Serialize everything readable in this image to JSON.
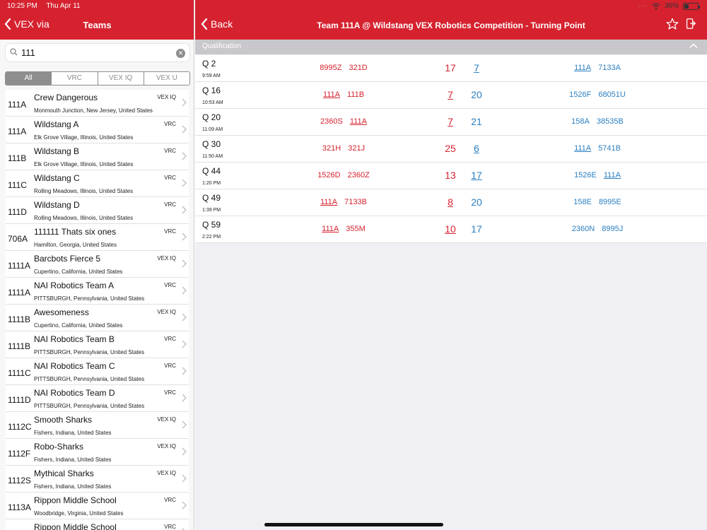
{
  "status": {
    "time": "10:25 PM",
    "date": "Thu Apr 11",
    "battery": "36%",
    "battery_level": 0.36
  },
  "left": {
    "back_label": "VEX via",
    "title": "Teams",
    "search_value": "111",
    "segments": [
      "All",
      "VRC",
      "VEX IQ",
      "VEX U"
    ],
    "teams": [
      {
        "number": "111A",
        "name": "Crew Dangerous",
        "location": "Monmouth Junction, New Jersey, United States",
        "program": "VEX IQ"
      },
      {
        "number": "111A",
        "name": "Wildstang A",
        "location": "Elk Grove Village, Illinois, United States",
        "program": "VRC"
      },
      {
        "number": "111B",
        "name": "Wildstang B",
        "location": "Elk Grove Village, Illinois, United States",
        "program": "VRC"
      },
      {
        "number": "111C",
        "name": "Wildstang C",
        "location": "Rolling Meadows, Illinois, United States",
        "program": "VRC"
      },
      {
        "number": "111D",
        "name": "Wildstang D",
        "location": "Rolling Meadows, Illinois, United States",
        "program": "VRC"
      },
      {
        "number": "706A",
        "name": "111111 Thats six ones",
        "location": "Hamilton, Georgia, United States",
        "program": "VRC"
      },
      {
        "number": "1111A",
        "name": "Barcbots Fierce 5",
        "location": "Cupertino, California, United States",
        "program": "VEX IQ"
      },
      {
        "number": "1111A",
        "name": "NAI Robotics Team A",
        "location": "PITTSBURGH, Pennsylvania, United States",
        "program": "VRC"
      },
      {
        "number": "1111B",
        "name": "Awesomeness",
        "location": "Cupertino, California, United States",
        "program": "VEX IQ"
      },
      {
        "number": "1111B",
        "name": "NAI Robotics Team B",
        "location": "PITTSBURGH, Pennsylvania, United States",
        "program": "VRC"
      },
      {
        "number": "1111C",
        "name": "NAI Robotics Team C",
        "location": "PITTSBURGH, Pennsylvania, United States",
        "program": "VRC"
      },
      {
        "number": "1111D",
        "name": "NAI Robotics Team D",
        "location": "PITTSBURGH, Pennsylvania, United States",
        "program": "VRC"
      },
      {
        "number": "1112C",
        "name": "Smooth Sharks",
        "location": "Fishers, Indiana, United States",
        "program": "VEX IQ"
      },
      {
        "number": "1112F",
        "name": "Robo-Sharks",
        "location": "Fishers, Indiana, United States",
        "program": "VEX IQ"
      },
      {
        "number": "1112S",
        "name": "Mythical Sharks",
        "location": "Fishers, Indiana, United States",
        "program": "VEX IQ"
      },
      {
        "number": "1113A",
        "name": "Rippon Middle School",
        "location": "Woodbridge, Virginia, United States",
        "program": "VRC"
      },
      {
        "number": "",
        "name": "Rippon Middle School",
        "location": "",
        "program": "VRC"
      }
    ]
  },
  "right": {
    "back_label": "Back",
    "title": "Team 111A @ Wildstang VEX Robotics Competition - Turning Point",
    "section_label": "Qualification",
    "matches": [
      {
        "name": "Q 2",
        "time": "9:59 AM",
        "red": [
          "8995Z",
          "321D"
        ],
        "red_score": "17",
        "blue_score": "7",
        "blue": [
          "111A",
          "7133A"
        ],
        "team_side": "blue",
        "team_idx": 0,
        "winner": "red"
      },
      {
        "name": "Q 16",
        "time": "10:53 AM",
        "red": [
          "111A",
          "111B"
        ],
        "red_score": "7",
        "blue_score": "20",
        "blue": [
          "1526F",
          "68051U"
        ],
        "team_side": "red",
        "team_idx": 0,
        "winner": "blue"
      },
      {
        "name": "Q 20",
        "time": "11:09 AM",
        "red": [
          "2360S",
          "111A"
        ],
        "red_score": "7",
        "blue_score": "21",
        "blue": [
          "158A",
          "38535B"
        ],
        "team_side": "red",
        "team_idx": 1,
        "winner": "blue"
      },
      {
        "name": "Q 30",
        "time": "11:50 AM",
        "red": [
          "321H",
          "321J"
        ],
        "red_score": "25",
        "blue_score": "6",
        "blue": [
          "111A",
          "5741B"
        ],
        "team_side": "blue",
        "team_idx": 0,
        "winner": "red"
      },
      {
        "name": "Q 44",
        "time": "1:20 PM",
        "red": [
          "1526D",
          "2360Z"
        ],
        "red_score": "13",
        "blue_score": "17",
        "blue": [
          "1526E",
          "111A"
        ],
        "team_side": "blue",
        "team_idx": 1,
        "winner": "blue"
      },
      {
        "name": "Q 49",
        "time": "1:39 PM",
        "red": [
          "111A",
          "7133B"
        ],
        "red_score": "8",
        "blue_score": "20",
        "blue": [
          "158E",
          "8995E"
        ],
        "team_side": "red",
        "team_idx": 0,
        "winner": "blue"
      },
      {
        "name": "Q 59",
        "time": "2:22 PM",
        "red": [
          "111A",
          "355M"
        ],
        "red_score": "10",
        "blue_score": "17",
        "blue": [
          "2360N",
          "8995J"
        ],
        "team_side": "red",
        "team_idx": 0,
        "winner": "blue"
      }
    ]
  }
}
